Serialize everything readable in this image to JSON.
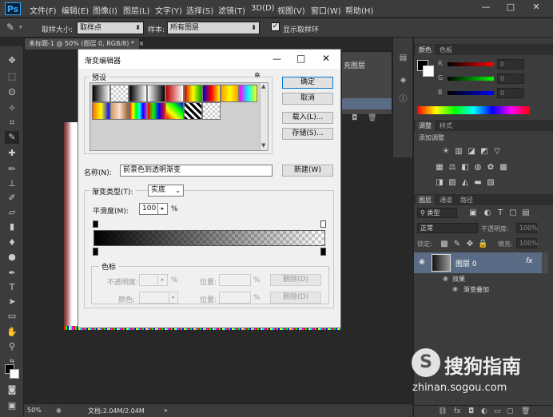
{
  "app": {
    "logo": "Ps"
  },
  "menu": [
    "文件(F)",
    "编辑(E)",
    "图像(I)",
    "图层(L)",
    "文字(Y)",
    "选择(S)",
    "滤镜(T)",
    "3D(D)",
    "视图(V)",
    "窗口(W)",
    "帮助(H)"
  ],
  "window_controls": {
    "minimize": "—",
    "maximize": "□",
    "close": "✕"
  },
  "options": {
    "sample_size_label": "取样大小:",
    "sample_size_value": "取样点",
    "sample_label": "样本:",
    "sample_value": "所有图层",
    "show_ring_label": "显示取样环"
  },
  "document": {
    "tab_title": "未标题-1 @ 50% (图层 0, RGB/8) *",
    "tab_close": "×"
  },
  "status": {
    "zoom": "50%",
    "doc_info": "文档:2.04M/2.04M"
  },
  "color_panel": {
    "tabs": [
      "颜色",
      "色板"
    ],
    "channels": [
      {
        "label": "R",
        "value": "0"
      },
      {
        "label": "G",
        "value": "0"
      },
      {
        "label": "B",
        "value": "0"
      }
    ]
  },
  "adjust_panel": {
    "tabs": [
      "调整",
      "样式"
    ],
    "title": "添加调整"
  },
  "layers_panel": {
    "tabs": [
      "图层",
      "通道",
      "路径"
    ],
    "kind_label": "类型",
    "blend_mode": "正常",
    "opacity_label": "不透明度:",
    "opacity_value": "100%",
    "lock_label": "锁定:",
    "fill_label": "填充:",
    "fill_value": "100%",
    "layer_name": "图层 0",
    "fx": "fx",
    "effects_label": "效果",
    "effect_item": "渐变叠加"
  },
  "bg_panel_fragment": "充图层",
  "gradient_editor": {
    "title": "渐变编辑器",
    "presets_label": "预设",
    "gear": "✲",
    "ok": "确定",
    "cancel": "取消",
    "load": "载入(L)...",
    "save": "存储(S)...",
    "name_label": "名称(N):",
    "name_value": "前景色到透明渐变",
    "new_button": "新建(W)",
    "type_label": "渐变类型(T):",
    "type_value": "实底",
    "smooth_label": "平滑度(M):",
    "smooth_value": "100",
    "smooth_unit": "%",
    "stops_label": "色标",
    "opacity_label": "不透明度:",
    "color_label": "颜色:",
    "location_label": "位置:",
    "percent": "%",
    "delete_label": "删除(D)",
    "close": "✕",
    "minimize": "—",
    "maximize": "□"
  },
  "watermark": {
    "text": "搜狗指南",
    "url": "zhinan.sogou.com",
    "logo_letter": "S"
  },
  "colors": {
    "accent": "#0078d7",
    "ps_blue": "#31a8ff",
    "panel_bg": "#3c3c3c",
    "workspace": "#282828"
  }
}
